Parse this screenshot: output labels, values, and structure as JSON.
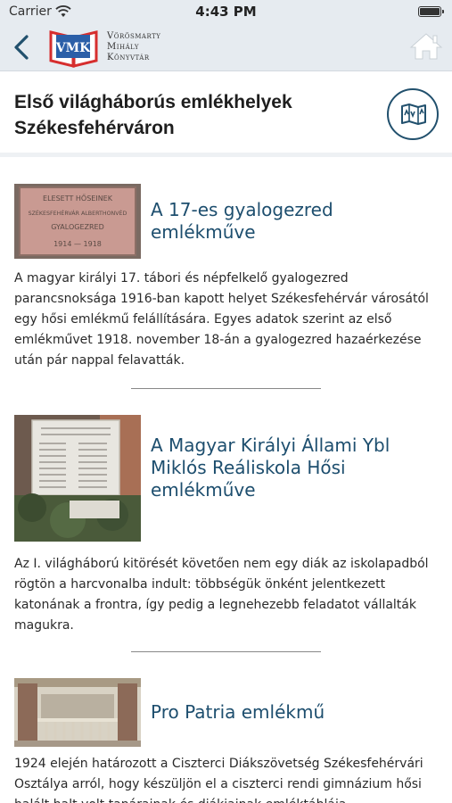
{
  "status_bar": {
    "carrier": "Carrier",
    "time": "4:43 PM"
  },
  "nav": {
    "back_icon": "chevron-left-icon",
    "logo_icon": "library-book-logo",
    "logo_lines": [
      "Vörösmarty",
      "Mihály",
      "Könyvtár"
    ],
    "home_icon": "home-icon"
  },
  "header": {
    "title": "Első világháborús emlékhelyek Székesfehérváron",
    "map_icon": "map-icon"
  },
  "items": [
    {
      "title": "A 17-es gyalogezred emlékműve",
      "description": "A magyar királyi 17. tábori és népfelkelő gyalogezred parancsnoksága 1916-ban kapott helyet Székesfehérvár városától egy hősi emlékmű felállítására. Egyes adatok szerint az első emlékművet 1918. november 18-án a gyalogezred hazaérkezése után pár nappal felavatták.",
      "thumb_text": [
        "ELESETT HŐSEINEK",
        "SZÉKESFEHÉRVÁR ALBERTHONVÉD",
        "GYALOGEZRED",
        "1914 — 1918"
      ]
    },
    {
      "title": "A Magyar Királyi Állami Ybl Miklós Reáliskola Hősi emlékműve",
      "description": "Az I. világháború kitörését követően nem egy diák az iskolapadból rögtön a harcvonalba indult: többségük önként jelentkezett katonának a frontra, így pedig a legnehezebb feladatot vállalták magukra."
    },
    {
      "title": "Pro Patria emlékmű",
      "description": "1924 elején határozott a Ciszterci Diákszövetség Székesfehérvári Osztálya arról, hogy készüljön el a ciszterci rendi gimnázium hősi halált halt volt tanárainak és diákjainak emléktáblája."
    }
  ],
  "colors": {
    "bar_bg": "#e6ebf0",
    "accent": "#1d4e6e",
    "logo_red": "#d62e2e",
    "logo_blue": "#2b5fa8"
  }
}
